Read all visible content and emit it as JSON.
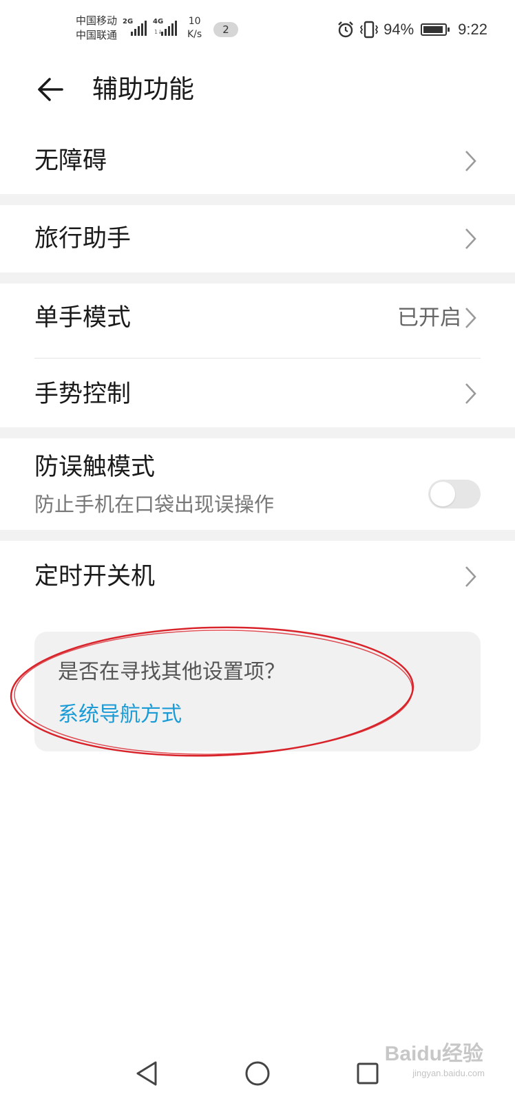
{
  "status_bar": {
    "carrier1": "中国移动",
    "carrier2": "中国联通",
    "sig1_gen": "2G",
    "sig2_gen": "4G",
    "sig2_sub": "1↓",
    "speed_value": "10",
    "speed_unit": "K/s",
    "notification_count": "2",
    "battery_percent": "94%",
    "time": "9:22"
  },
  "header": {
    "title": "辅助功能",
    "back_icon": "arrow-left-icon"
  },
  "list": {
    "accessibility": "无障碍",
    "travel_assistant": "旅行助手",
    "one_hand_mode": "单手模式",
    "one_hand_mode_status": "已开启",
    "gesture_control": "手势控制",
    "pocket_mode": "防误触模式",
    "pocket_mode_desc": "防止手机在口袋出现误操作",
    "pocket_mode_enabled": false,
    "scheduled_power": "定时开关机"
  },
  "suggestion": {
    "question": "是否在寻找其他设置项？",
    "link": "系统导航方式"
  },
  "watermark": {
    "brand": "Baidu经验",
    "url": "jingyan.baidu.com"
  },
  "colors": {
    "link": "#1b9bd6",
    "annotation": "#d8232a",
    "section_gap": "#f2f2f2",
    "card": "#f1f1f1"
  }
}
